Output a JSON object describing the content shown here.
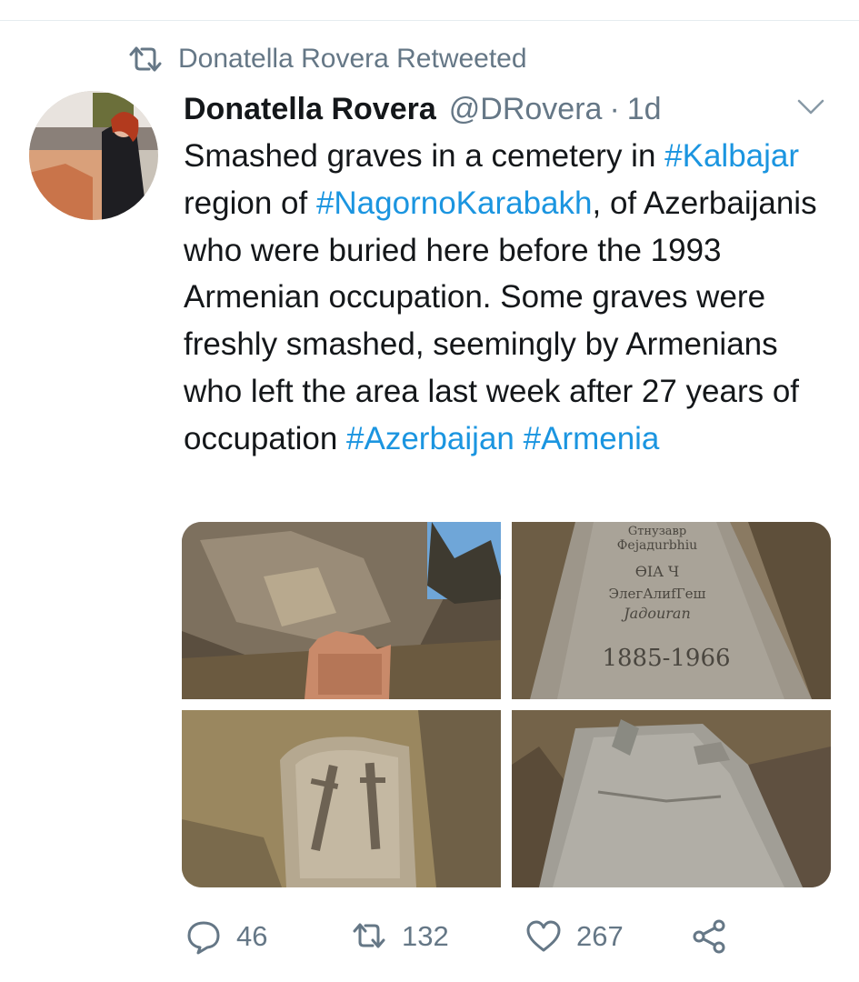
{
  "retweet_banner": {
    "text": "Donatella Rovera Retweeted",
    "icon": "retweet-icon"
  },
  "tweet": {
    "author_name": "Donatella Rovera",
    "handle": "@DRovera",
    "separator": "·",
    "time": "1d",
    "text_segments": [
      "Smashed graves in a cemetery in ",
      "#Kalbajar",
      " region of ",
      "#NagornoKarabakh",
      ", of Azerbaijanis who were buried here before the 1993 Armenian occupation. Some graves were freshly smashed, seemingly by Armenians who left the area last week after 27 years of occupation ",
      "#Azerbaijan",
      " ",
      "#Armenia"
    ],
    "photo_inscriptions": {
      "line1": "Gтнузавр",
      "line2": "Фejaдurbhiu",
      "line3": "ӨIA Ч",
      "line4": "ЭлегАлиfГеш",
      "line5": "Jaдоuran",
      "dates": "1885-1966"
    }
  },
  "actions": {
    "reply_count": "46",
    "retweet_count": "132",
    "like_count": "267"
  },
  "colors": {
    "link": "#1b95e0",
    "secondary": "#657786",
    "text": "#14171a"
  }
}
